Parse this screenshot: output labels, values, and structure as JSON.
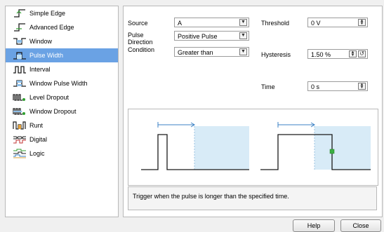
{
  "triggers": [
    {
      "label": "Simple Edge",
      "icon": "simple-edge-icon"
    },
    {
      "label": "Advanced Edge",
      "icon": "advanced-edge-icon"
    },
    {
      "label": "Window",
      "icon": "window-icon"
    },
    {
      "label": "Pulse Width",
      "icon": "pulse-width-icon",
      "selected": true
    },
    {
      "label": "Interval",
      "icon": "interval-icon"
    },
    {
      "label": "Window Pulse Width",
      "icon": "window-pulse-width-icon"
    },
    {
      "label": "Level Dropout",
      "icon": "level-dropout-icon"
    },
    {
      "label": "Window Dropout",
      "icon": "window-dropout-icon"
    },
    {
      "label": "Runt",
      "icon": "runt-icon"
    },
    {
      "label": "Digital",
      "icon": "digital-icon"
    },
    {
      "label": "Logic",
      "icon": "logic-icon"
    }
  ],
  "settings": {
    "source_label": "Source",
    "source_value": "A",
    "pulse_direction_label_1": "Pulse",
    "pulse_direction_label_2": "Direction",
    "pulse_direction_value": "Positive Pulse",
    "condition_label": "Condition",
    "condition_value": "Greater than",
    "threshold_label": "Threshold",
    "threshold_value": "0 V",
    "hysteresis_label": "Hysteresis",
    "hysteresis_value": "1.50 %",
    "time_label": "Time",
    "time_value": "0 s"
  },
  "description": "Trigger when the pulse is longer than the specified time.",
  "buttons": {
    "help": "Help",
    "close": "Close"
  },
  "colors": {
    "selection": "#6aa2e4",
    "shade": "#d8ebf7",
    "arrow": "#3b82c4",
    "trigger_point": "#3cb043"
  }
}
